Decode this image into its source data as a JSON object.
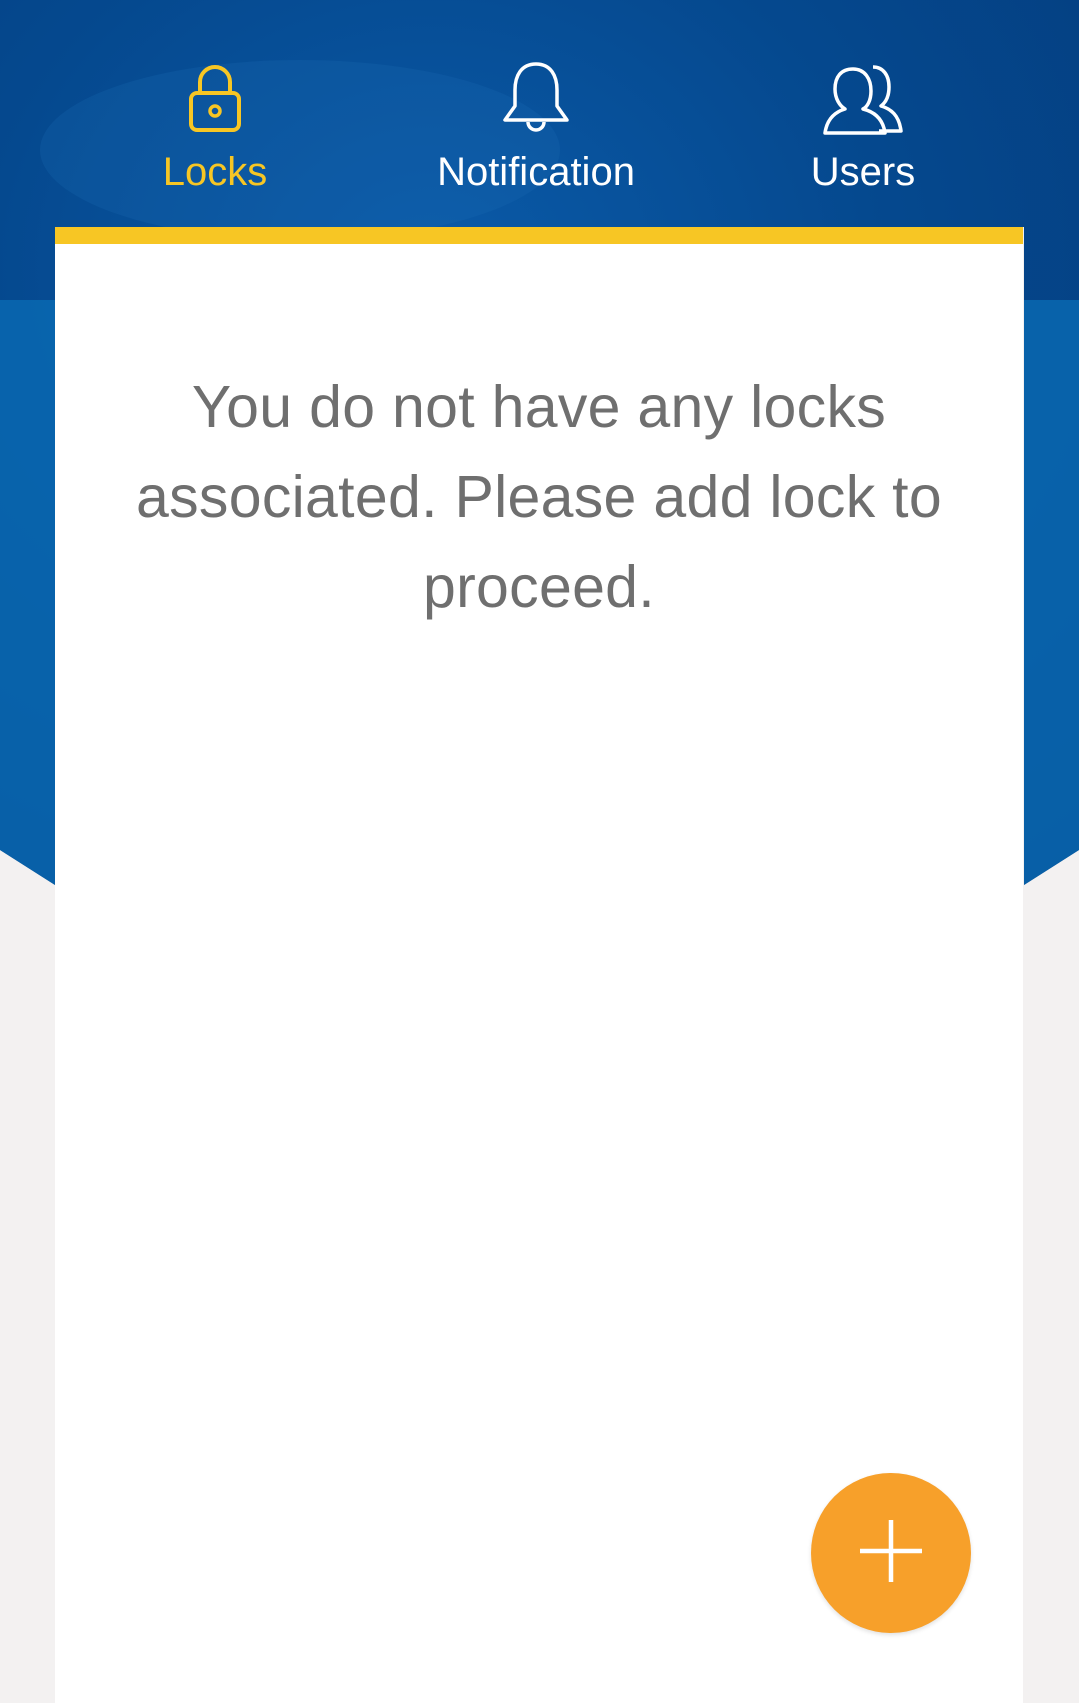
{
  "tabs": [
    {
      "id": "locks",
      "label": "Locks",
      "icon": "lock-icon",
      "active": true
    },
    {
      "id": "notification",
      "label": "Notification",
      "icon": "bell-icon",
      "active": false
    },
    {
      "id": "users",
      "label": "Users",
      "icon": "users-icon",
      "active": false
    }
  ],
  "main": {
    "empty_message": "You do not have any locks associated. Please add lock to proceed."
  },
  "fab": {
    "icon": "plus-icon"
  },
  "colors": {
    "active_tab": "#f7c624",
    "inactive_tab": "#ffffff",
    "header_blue": "#0a4f99",
    "accent_bar": "#f7c624",
    "fab": "#f7a02a",
    "message_text": "#6f6f6f"
  }
}
